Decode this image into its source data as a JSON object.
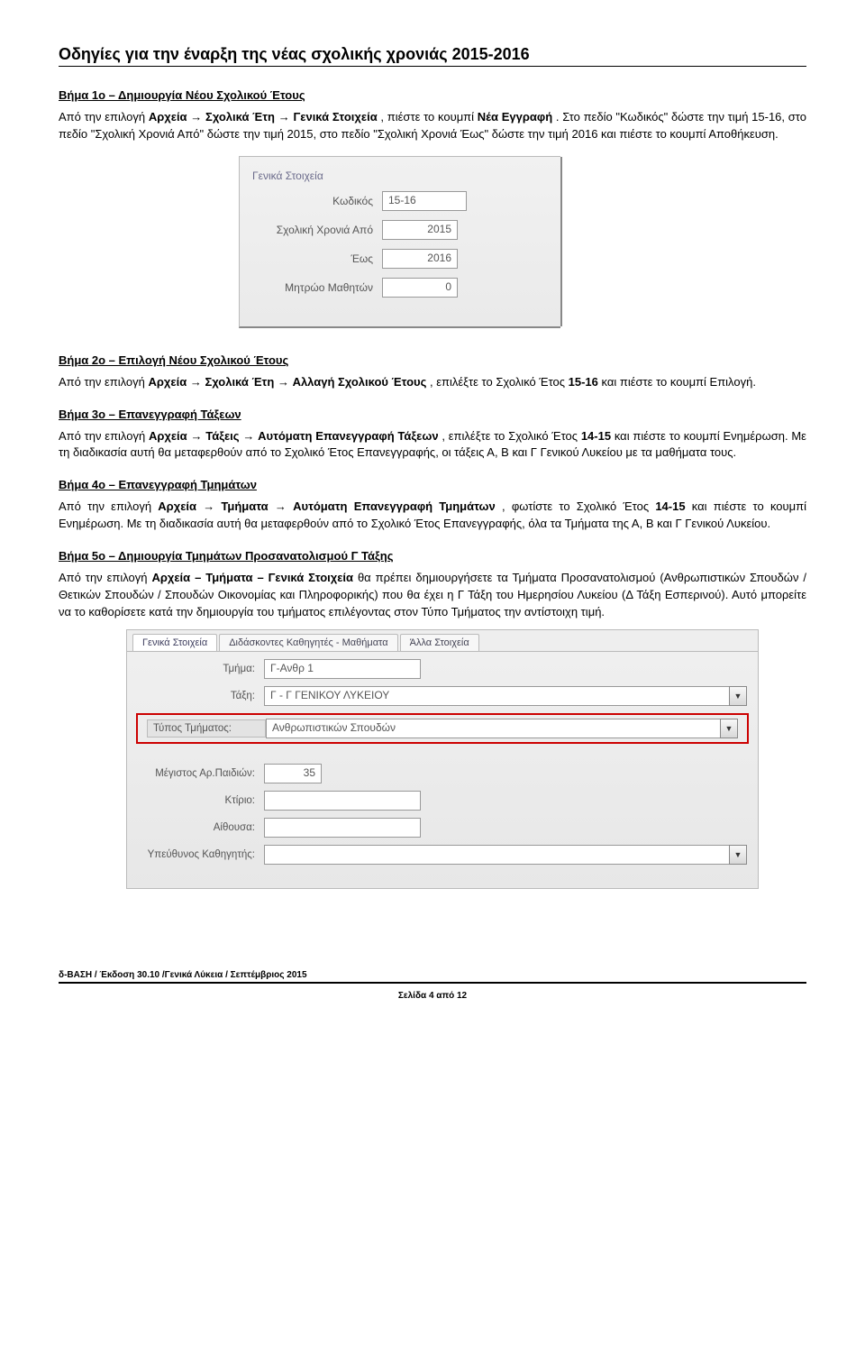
{
  "title": "Οδηγίες για την έναρξη της νέας σχολικής χρονιάς 2015-2016",
  "step1": {
    "header": "Βήμα 1ο – Δημιουργία Νέου Σχολικού Έτους",
    "p1a": "Από την επιλογή ",
    "p1b": "Αρχεία",
    "p1c": " → ",
    "p1d": "Σχολικά Έτη",
    "p1e": " → ",
    "p1f": "Γενικά Στοιχεία",
    "p1g": ", πιέστε το κουμπί ",
    "p1h": "Νέα Εγγραφή",
    "p1i": ". Στο πεδίο \"Κωδικός\" δώστε την τιμή 15-16, στο πεδίο \"Σχολική Χρονιά Από\" δώστε την τιμή 2015, στο πεδίο \"Σχολική Χρονιά Έως\" δώστε την τιμή 2016 και πιέστε το κουμπί Αποθήκευση."
  },
  "fig1": {
    "section": "Γενικά Στοιχεία",
    "code_label": "Κωδικός",
    "code_value": "15-16",
    "from_label": "Σχολική Χρονιά Από",
    "from_value": "2015",
    "to_label": "Έως",
    "to_value": "2016",
    "reg_label": "Μητρώο Μαθητών",
    "reg_value": "0"
  },
  "step2": {
    "header": "Βήμα 2ο – Επιλογή Νέου Σχολικού Έτους",
    "p1a": "Από την επιλογή ",
    "p1b": "Αρχεία",
    "p1c": " → ",
    "p1d": "Σχολικά Έτη",
    "p1e": " → ",
    "p1f": "Αλλαγή Σχολικού Έτους",
    "p1g": ", επιλέξτε το Σχολικό Έτος ",
    "p1h": "15-16",
    "p1i": " και πιέστε το κουμπί Επιλογή."
  },
  "step3": {
    "header": "Βήμα 3ο – Επανεγγραφή Τάξεων",
    "p1a": "Από την επιλογή ",
    "p1b": "Αρχεία",
    "p1c": " → ",
    "p1d": "Τάξεις",
    "p1e": " → ",
    "p1f": "Αυτόματη Επανεγγραφή Τάξεων",
    "p1g": ", επιλέξτε το Σχολικό Έτος ",
    "p1h": "14-15",
    "p1i": " και πιέστε το κουμπί Ενημέρωση. Με τη διαδικασία αυτή θα μεταφερθούν από το Σχολικό Έτος Επανεγγραφής, οι τάξεις Α, Β και Γ Γενικού Λυκείου με τα μαθήματα τους."
  },
  "step4": {
    "header": "Βήμα 4ο – Επανεγγραφή Τμημάτων",
    "p1a": "Από την επιλογή ",
    "p1b": "Αρχεία",
    "p1c": " → ",
    "p1d": "Τμήματα",
    "p1e": " → ",
    "p1f": "Αυτόματη Επανεγγραφή Τμημάτων",
    "p1g": ", φωτίστε το Σχολικό Έτος ",
    "p1h": "14-15",
    "p1i": " και πιέστε το κουμπί Ενημέρωση. Με τη διαδικασία αυτή θα μεταφερθούν από το Σχολικό Έτος Επανεγγραφής, όλα τα Τμήματα της Α, Β και Γ Γενικού Λυκείου."
  },
  "step5": {
    "header": "Βήμα 5ο – Δημιουργία Τμημάτων Προσανατολισμού Γ Τάξης",
    "p1a": "Από την επιλογή ",
    "p1b": "Αρχεία – Τμήματα – Γενικά Στοιχεία",
    "p1c": " θα πρέπει δημιουργήσετε τα Τμήματα Προσανατολισμού (Ανθρωπιστικών Σπουδών / Θετικών Σπουδών / Σπουδών Οικονομίας και Πληροφορικής) που θα έχει η Γ Τάξη του Ημερησίου Λυκείου (Δ Τάξη Εσπερινού). Αυτό μπορείτε να το καθορίσετε κατά την δημιουργία του τμήματος επιλέγοντας στον Τύπο Τμήματος την αντίστοιχη τιμή."
  },
  "fig2": {
    "tab1": "Γενικά Στοιχεία",
    "tab2": "Διδάσκοντες Καθηγητές - Μαθήματα",
    "tab3": "Άλλα Στοιχεία",
    "tmima_label": "Τμήμα:",
    "tmima_value": "Γ-Ανθρ 1",
    "taxi_label": "Τάξη:",
    "taxi_value": "Γ - Γ ΓΕΝΙΚΟΥ ΛΥΚΕΙΟΥ",
    "typos_label": "Τύπος Τμήματος:",
    "typos_value": "Ανθρωπιστικών Σπουδών",
    "max_label": "Μέγιστος Αρ.Παιδιών:",
    "max_value": "35",
    "ktirio_label": "Κτίριο:",
    "aithousa_label": "Αίθουσα:",
    "ypef_label": "Υπεύθυνος Καθηγητής:"
  },
  "footer": {
    "line": "δ-ΒΑΣΗ / Έκδοση 30.10 /Γενικά Λύκεια / Σεπτέμβριος 2015",
    "page": "Σελίδα 4 από 12"
  }
}
